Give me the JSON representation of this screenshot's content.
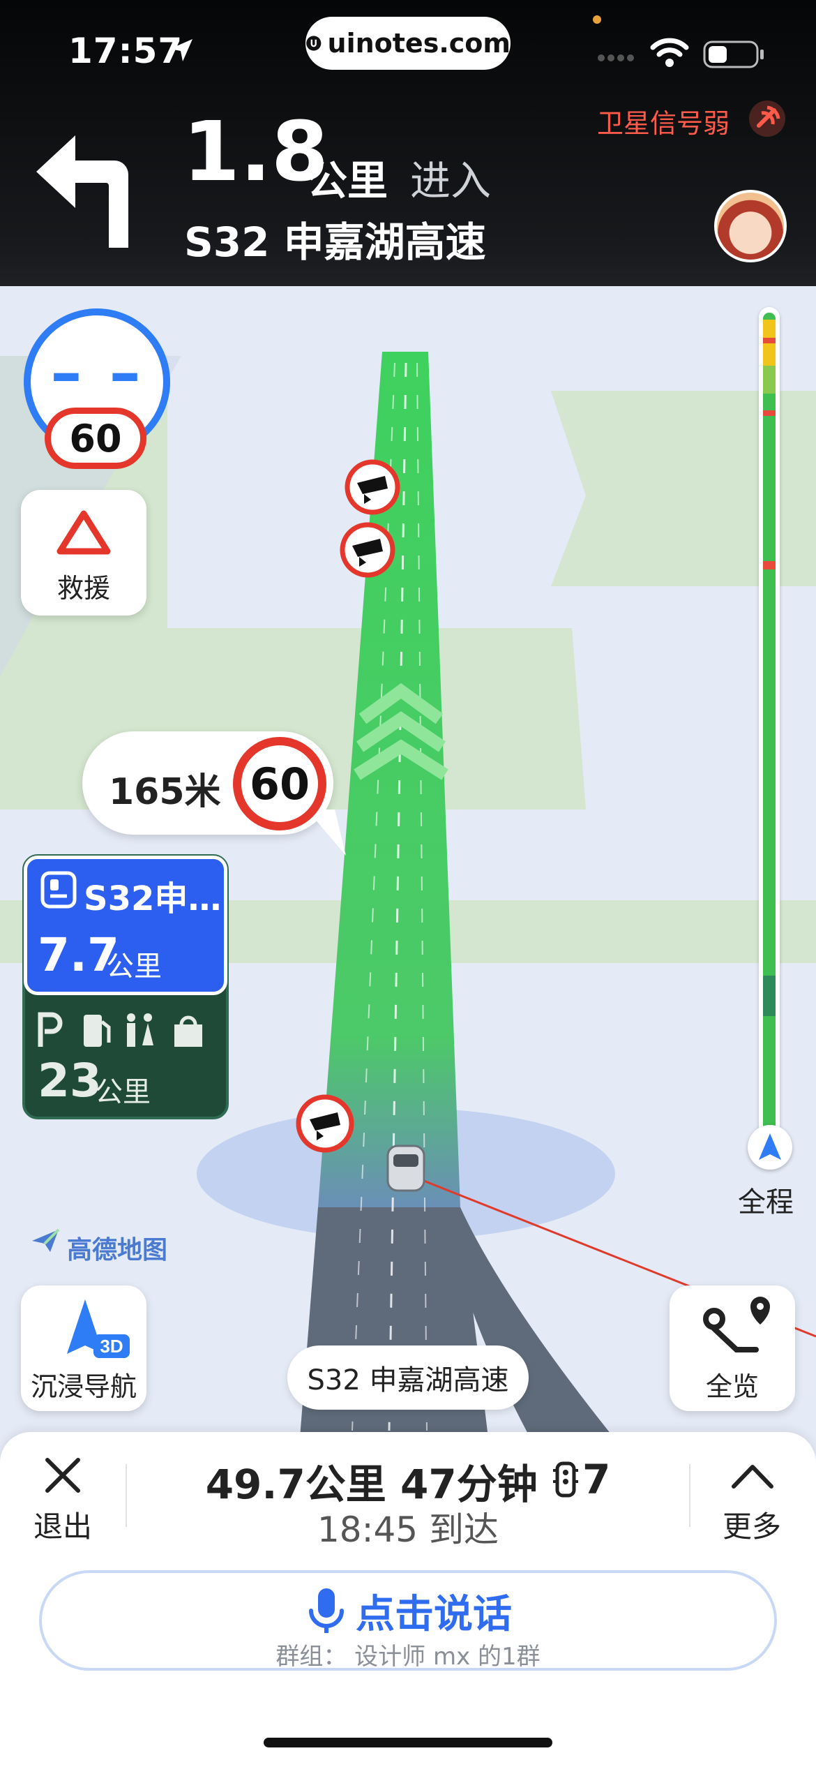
{
  "status_bar": {
    "time": "17:57",
    "url": "uinotes.com"
  },
  "nav_header": {
    "distance_value": "1.8",
    "distance_unit": "公里",
    "action": "进入",
    "road_name": "S32 申嘉湖高速",
    "signal_warning": "卫星信号弱",
    "turn_icon": "turn-left-arrow"
  },
  "speed": {
    "current": "– –",
    "limit": "60"
  },
  "rescue": {
    "label": "救援"
  },
  "camera_bubble": {
    "distance": "165米",
    "limit": "60"
  },
  "exit_card": {
    "road": "S32申…",
    "distance": "7.7",
    "distance_unit": "公里",
    "service_distance": "23",
    "service_unit": "公里"
  },
  "progress": {
    "label": "全程",
    "fraction_complete": 0.02
  },
  "map": {
    "brand": "高德地图",
    "current_road": "S32 申嘉湖高速",
    "route_color": "#3fd15e",
    "route_glow_color": "#6ee07b"
  },
  "map_buttons": {
    "immersive": "沉浸导航",
    "immersive_badge": "3D",
    "overview": "全览"
  },
  "bottom_sheet": {
    "exit_label": "退出",
    "remaining_distance": "49.7公里",
    "remaining_time": "47分钟",
    "traffic_lights": "7",
    "arrival": "18:45 到达",
    "more_label": "更多",
    "voice_label": "点击说话",
    "voice_group": "群组： 设计师 mx 的1群"
  },
  "colors": {
    "accent_blue": "#2e7cf6",
    "warning_red": "#e5362b",
    "header_bg": "#141619"
  }
}
